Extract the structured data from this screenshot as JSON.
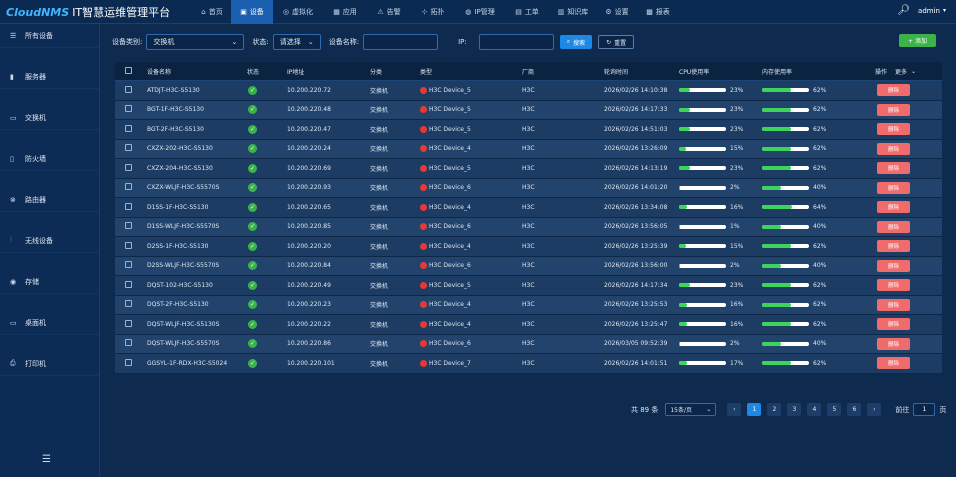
{
  "header": {
    "brand": "CloudNMS",
    "title": "IT智慧运维管理平台",
    "nav": [
      {
        "label": "首页",
        "icon": "⌂",
        "name": "home",
        "w": 38
      },
      {
        "label": "设备",
        "icon": "▣",
        "name": "device",
        "w": 42
      },
      {
        "label": "虚拟化",
        "icon": "◎",
        "name": "virtual",
        "w": 50
      },
      {
        "label": "应用",
        "icon": "▦",
        "name": "app",
        "w": 44
      },
      {
        "label": "告警",
        "icon": "⚠",
        "name": "alarm",
        "w": 44
      },
      {
        "label": "拓扑",
        "icon": "⊹",
        "name": "topology",
        "w": 44
      },
      {
        "label": "IP管理",
        "icon": "◍",
        "name": "ip",
        "w": 50
      },
      {
        "label": "工单",
        "icon": "▤",
        "name": "ticket",
        "w": 44
      },
      {
        "label": "知识库",
        "icon": "▥",
        "name": "kb",
        "w": 48
      },
      {
        "label": "设置",
        "icon": "⚙",
        "name": "settings",
        "w": 40
      },
      {
        "label": "报表",
        "icon": "▩",
        "name": "report",
        "w": 42
      }
    ],
    "user": "admin"
  },
  "sidebar": {
    "items": [
      {
        "label": "所有设备",
        "icon": "☰",
        "name": "all"
      },
      {
        "label": "服务器",
        "icon": "▮",
        "name": "server"
      },
      {
        "label": "交换机",
        "icon": "▭",
        "name": "switch"
      },
      {
        "label": "防火墙",
        "icon": "▯",
        "name": "firewall"
      },
      {
        "label": "路由器",
        "icon": "⊗",
        "name": "router"
      },
      {
        "label": "无线设备",
        "icon": "⫶",
        "name": "wireless"
      },
      {
        "label": "存储",
        "icon": "◉",
        "name": "storage"
      },
      {
        "label": "桌面机",
        "icon": "▭",
        "name": "desktop"
      },
      {
        "label": "打印机",
        "icon": "⎙",
        "name": "printer"
      }
    ]
  },
  "filters": {
    "category_label": "设备类别:",
    "category_value": "交换机",
    "status_label": "状态:",
    "status_value": "请选择",
    "name_label": "设备名称:",
    "ip_label": "IP:",
    "search_btn": "搜索",
    "reset_btn": "重置",
    "add_btn": "+ 添加"
  },
  "table": {
    "headers": {
      "name": "设备名称",
      "status": "状态",
      "ip": "IP地址",
      "category": "分类",
      "type": "类型",
      "vendor": "厂商",
      "time": "轮询时间",
      "cpu": "CPU使用率",
      "mem": "内存使用率",
      "op": "操作",
      "more": "更多"
    },
    "delete_label": "删除",
    "rows": [
      {
        "name": "ATDJT-H3C-S5130",
        "ip": "10.200.220.72",
        "cat": "交换机",
        "type": "H3C Device_5",
        "vendor": "H3C",
        "time": "2026/02/26 14:10:38",
        "cpu": 23,
        "mem": 62
      },
      {
        "name": "BGT-1F-H3C-S5130",
        "ip": "10.200.220.48",
        "cat": "交换机",
        "type": "H3C Device_5",
        "vendor": "H3C",
        "time": "2026/02/26 14:17:33",
        "cpu": 23,
        "mem": 62
      },
      {
        "name": "BGT-2F-H3C-S5130",
        "ip": "10.200.220.47",
        "cat": "交换机",
        "type": "H3C Device_5",
        "vendor": "H3C",
        "time": "2026/02/26 14:51:03",
        "cpu": 23,
        "mem": 62
      },
      {
        "name": "CXZX-202-H3C-S5130",
        "ip": "10.200.220.24",
        "cat": "交换机",
        "type": "H3C Device_4",
        "vendor": "H3C",
        "time": "2026/02/26 13:26:09",
        "cpu": 15,
        "mem": 62
      },
      {
        "name": "CXZX-204-H3C-S5130",
        "ip": "10.200.220.69",
        "cat": "交换机",
        "type": "H3C Device_5",
        "vendor": "H3C",
        "time": "2026/02/26 14:13:19",
        "cpu": 23,
        "mem": 62
      },
      {
        "name": "CXZX-WLJF-H3C-S5570S",
        "ip": "10.200.220.93",
        "cat": "交换机",
        "type": "H3C Device_6",
        "vendor": "H3C",
        "time": "2026/02/26 14:01:20",
        "cpu": 2,
        "mem": 40
      },
      {
        "name": "D1SS-1F-H3C-S5130",
        "ip": "10.200.220.65",
        "cat": "交换机",
        "type": "H3C Device_4",
        "vendor": "H3C",
        "time": "2026/02/26 13:34:08",
        "cpu": 16,
        "mem": 64
      },
      {
        "name": "D1SS-WLJF-H3C-S5570S",
        "ip": "10.200.220.85",
        "cat": "交换机",
        "type": "H3C Device_6",
        "vendor": "H3C",
        "time": "2026/02/26 13:56:05",
        "cpu": 1,
        "mem": 40
      },
      {
        "name": "D2SS-1F-H3C-S5130",
        "ip": "10.200.220.20",
        "cat": "交换机",
        "type": "H3C Device_4",
        "vendor": "H3C",
        "time": "2026/02/26 13:25:39",
        "cpu": 15,
        "mem": 62
      },
      {
        "name": "D2SS-WLJF-H3C-S5570S",
        "ip": "10.200.220.84",
        "cat": "交换机",
        "type": "H3C Device_6",
        "vendor": "H3C",
        "time": "2026/02/26 13:56:00",
        "cpu": 2,
        "mem": 40
      },
      {
        "name": "DQST-102-H3C-S5130",
        "ip": "10.200.220.49",
        "cat": "交换机",
        "type": "H3C Device_5",
        "vendor": "H3C",
        "time": "2026/02/26 14:17:34",
        "cpu": 23,
        "mem": 62
      },
      {
        "name": "DQST-2F-H3C-S5130",
        "ip": "10.200.220.23",
        "cat": "交换机",
        "type": "H3C Device_4",
        "vendor": "H3C",
        "time": "2026/02/26 13:25:53",
        "cpu": 16,
        "mem": 62
      },
      {
        "name": "DQST-WLJF-H3C-S5130S",
        "ip": "10.200.220.22",
        "cat": "交换机",
        "type": "H3C Device_4",
        "vendor": "H3C",
        "time": "2026/02/26 13:25:47",
        "cpu": 16,
        "mem": 62
      },
      {
        "name": "DQST-WLJF-H3C-S5570S",
        "ip": "10.200.220.86",
        "cat": "交换机",
        "type": "H3C Device_6",
        "vendor": "H3C",
        "time": "2026/03/05 09:52:39",
        "cpu": 2,
        "mem": 40
      },
      {
        "name": "GGSYL-1F-RDX-H3C-S5024",
        "ip": "10.200.220.101",
        "cat": "交换机",
        "type": "H3C Device_7",
        "vendor": "H3C",
        "time": "2026/02/26 14:01:51",
        "cpu": 17,
        "mem": 62
      }
    ]
  },
  "pager": {
    "total": "共 89 条",
    "size": "15条/页",
    "prev": "‹",
    "next": "›",
    "pages": [
      "1",
      "2",
      "3",
      "4",
      "5",
      "6"
    ],
    "current": "1",
    "goto_label": "前往",
    "goto_value": "1",
    "page_unit": "页"
  },
  "colors": {
    "accent": "#1e88e5",
    "ok": "#3cb34a",
    "alert": "#e53935",
    "danger_btn": "#f06b6b"
  }
}
